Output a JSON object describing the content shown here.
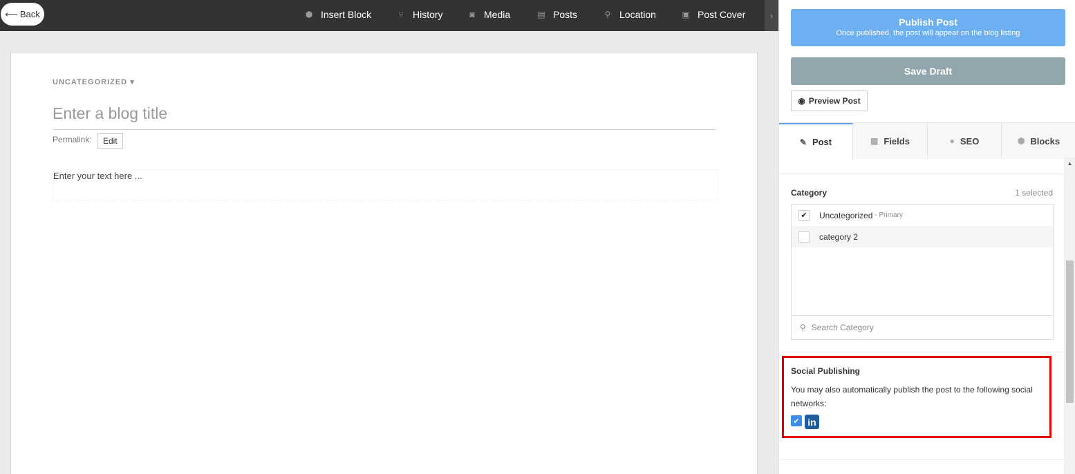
{
  "toolbar": {
    "back_label": "Back",
    "items": [
      {
        "label": "Insert Block",
        "icon": "cube-icon"
      },
      {
        "label": "History",
        "icon": "branch-icon"
      },
      {
        "label": "Media",
        "icon": "camera-icon"
      },
      {
        "label": "Posts",
        "icon": "document-icon"
      },
      {
        "label": "Location",
        "icon": "map-pin-icon"
      },
      {
        "label": "Post Cover",
        "icon": "image-icon"
      }
    ],
    "more_icon": "chevron-right-icon"
  },
  "editor": {
    "category_dropdown": "UNCATEGORIZED",
    "title_placeholder": "Enter a blog title",
    "permalink_label": "Permalink:",
    "edit_label": "Edit",
    "text_placeholder": "Enter your text here ..."
  },
  "panel": {
    "publish_label": "Publish Post",
    "publish_sub": "Once published, the post will appear on the blog listing",
    "draft_label": "Save Draft",
    "preview_label": "Preview Post",
    "tabs": [
      {
        "label": "Post",
        "icon": "pencil-icon",
        "active": true
      },
      {
        "label": "Fields",
        "icon": "grid-icon",
        "active": false
      },
      {
        "label": "SEO",
        "icon": "globe-icon",
        "active": false
      },
      {
        "label": "Blocks",
        "icon": "cube-icon",
        "active": false
      }
    ],
    "category": {
      "label": "Category",
      "count": "1 selected",
      "items": [
        {
          "label": "Uncategorized",
          "tag": "- Primary",
          "checked": true
        },
        {
          "label": "category 2",
          "tag": "",
          "checked": false
        }
      ],
      "search_placeholder": "Search Category"
    },
    "social": {
      "title": "Social Publishing",
      "description": "You may also automatically publish the post to the following social networks:",
      "network": "linkedin",
      "network_label": "in",
      "checked": true
    }
  },
  "colors": {
    "toolbar_bg": "#333333",
    "publish": "#6cb0f2",
    "draft": "#93a6ae",
    "highlight": "#e00000",
    "linkedin": "#1e5e9e",
    "checkbox": "#3d8ee8"
  }
}
